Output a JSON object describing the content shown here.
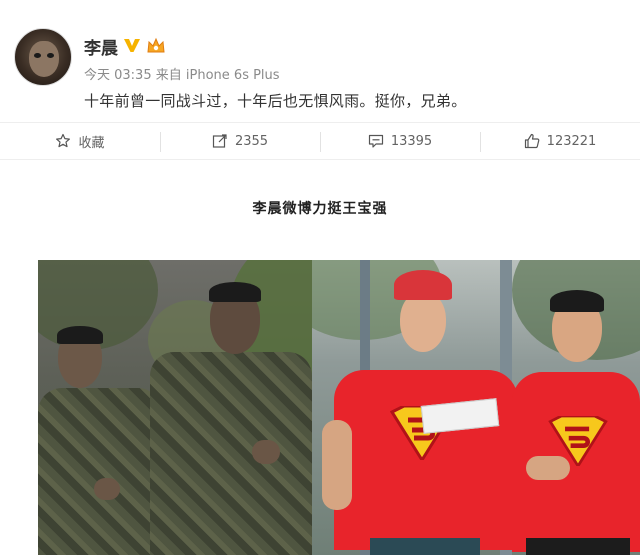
{
  "post": {
    "username": "李晨",
    "time": "今天 03:35",
    "source_prefix": "来自",
    "device": "iPhone 6s Plus",
    "text": "十年前曾一同战斗过，十年后也无惧风雨。挺你，兄弟。"
  },
  "actions": {
    "favorite_label": "收藏",
    "repost_count": "2355",
    "comment_count": "13395",
    "like_count": "123221"
  },
  "article": {
    "caption": "李晨微博力挺王宝强"
  },
  "colors": {
    "verified": "#f6b300",
    "text": "#333333",
    "meta": "#8a8a8a",
    "shirt_red": "#e8242b"
  }
}
